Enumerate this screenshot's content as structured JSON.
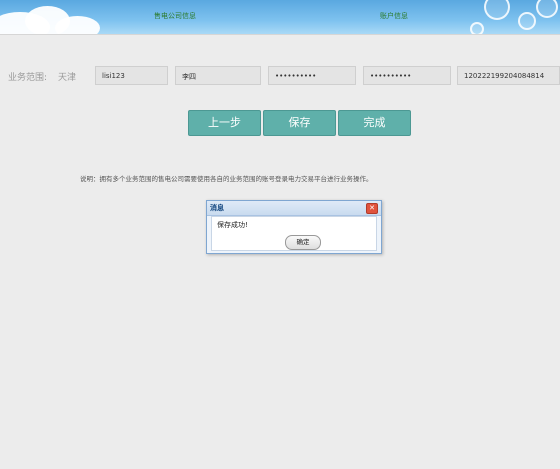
{
  "steps": {
    "step_left": "售电公司信息",
    "step_right": "账户信息"
  },
  "form": {
    "scope_label": "业务范围:",
    "scope_value": "天津",
    "username": "lisi123",
    "real_name": "李四",
    "password": "••••••••••",
    "password_confirm": "••••••••••",
    "id_number": "120222199204084814"
  },
  "buttons": {
    "prev": "上一步",
    "save": "保存",
    "finish": "完成"
  },
  "note": "说明：拥有多个业务范围的售电公司需要使用各自的业务范围的账号登录电力交易平台进行业务操作。",
  "dialog": {
    "title": "消息",
    "close": "✕",
    "message": "保存成功!",
    "ok": "确定"
  },
  "colors": {
    "primary_button": "#5fb0aa",
    "banner": "#6ab8ea",
    "dialog_title": "#0a3f7a",
    "close_button": "#e0533d"
  }
}
